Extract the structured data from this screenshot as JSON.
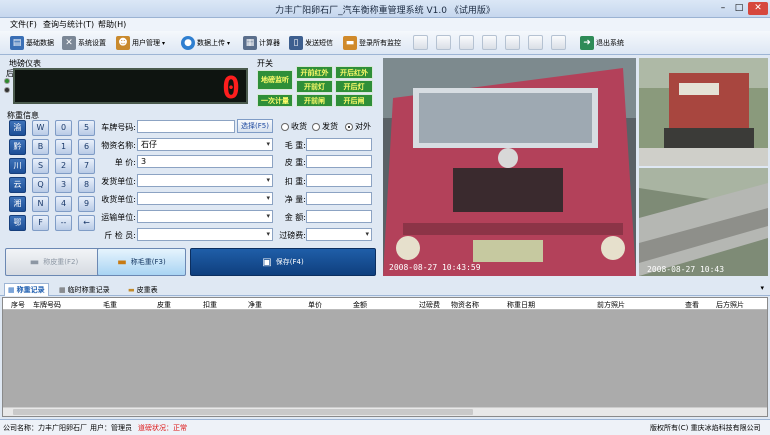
{
  "window": {
    "title": "力丰广阳卵石厂_汽车衡称重管理系统 V1.0 《试用版》"
  },
  "menu": [
    "文件(F)",
    "查询与统计(T)",
    "帮助(H)"
  ],
  "toolbar": {
    "basic_data": "基础数据",
    "system_settings": "系统设置",
    "user_management": "用户管理",
    "data_upload": "数据上传",
    "calculator": "计算器",
    "send_sms": "发送短信",
    "login_monitor": "登录所有监控",
    "exit_system": "退出系统"
  },
  "scale_meter": {
    "label": "地磅仪表",
    "rear": "后",
    "front": "前",
    "reading": "0"
  },
  "switch": {
    "label": "开关",
    "buttons": [
      "地磅监听",
      "开前红外",
      "开后红外",
      "开前灯",
      "开后灯",
      "一次计量",
      "开前闸",
      "开后闸"
    ]
  },
  "weigh_info": {
    "label": "称重信息",
    "keypad": [
      "渝",
      "W",
      "0",
      "5",
      "黔",
      "B",
      "1",
      "6",
      "川",
      "S",
      "2",
      "7",
      "云",
      "Q",
      "3",
      "8",
      "湘",
      "N",
      "4",
      "9",
      "鄂",
      "F",
      "--",
      "←"
    ]
  },
  "form": {
    "plate_label": "车牌号码:",
    "plate_value": "",
    "select_button": "选择(F5)",
    "radio_receive": "收货",
    "radio_send": "发货",
    "radio_external": "对外",
    "material_label": "物资名称:",
    "material_value": "石仔",
    "price_label": "单    价:",
    "price_value": "3",
    "sender_label": "发货单位:",
    "receiver_label": "收货单位:",
    "transport_label": "运输单位:",
    "inspector_label": "斤 检 员:",
    "gross_label": "毛  重:",
    "tare_label": "皮  重:",
    "deduct_label": "扣  重:",
    "net_label": "净  量:",
    "amount_label": "金  额:",
    "fee_label": "过磅费:"
  },
  "actions": {
    "tare_button": "称皮重(F2)",
    "gross_button": "称毛重(F3)",
    "save_button": "保存(F4)"
  },
  "cameras": {
    "main_stamp": "2008-08-27 10:43:59",
    "side_top_stamp": "",
    "side_bottom_stamp": "2008-08-27 10:43"
  },
  "tabs": [
    "称重记录",
    "临时称重记录",
    "皮重表"
  ],
  "grid_columns": [
    "序号",
    "车牌号码",
    "毛重",
    "皮重",
    "扣重",
    "净重",
    "单价",
    "金额",
    "过磅费",
    "物资名称",
    "称重日期",
    "前方照片",
    "查看",
    "后方照片"
  ],
  "status": {
    "company": "公司名称：力丰广阳卵石厂",
    "user": "用户：管理员",
    "scale_status": "道磅状况：正常",
    "copyright": "版权所有(C) 重庆冰焰科技有限公司"
  }
}
